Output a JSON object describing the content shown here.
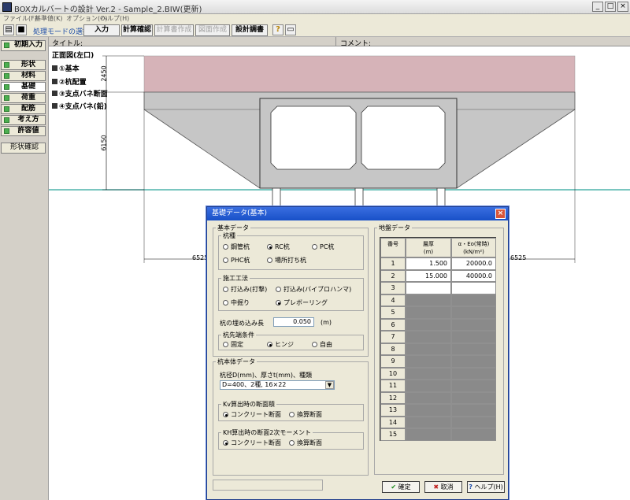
{
  "window": {
    "title": "BOXカルバートの設計 Ver.2 - Sample_2.BIW(更新)",
    "minimize": "_",
    "maximize": "□",
    "close": "×"
  },
  "menu": [
    "ファイル(F)",
    "基準値(K)",
    "オプション(O)",
    "ヘルプ(H)"
  ],
  "toolbar": {
    "mode_label": "処理モードの選択",
    "input": "入力",
    "calc_confirm": "計算確認",
    "calc_doc": "計算書作成",
    "drawing": "図面作成",
    "design_doc": "設計調書",
    "help_icon": "?",
    "open_icon": "📂",
    "save_icon": "💾"
  },
  "leftpanel": {
    "initial": "初期入力",
    "items": [
      "形状",
      "材料",
      "基礎",
      "荷重",
      "配筋",
      "考え方",
      "許容値"
    ],
    "shape_confirm": "形状確認"
  },
  "main": {
    "title_label": "タイトル:",
    "comment_label": "コメント:",
    "view_title": "正面図(左口)",
    "layers": [
      "①基本",
      "②杭配置",
      "③支点バネ断面",
      "④支点バネ(鉛)"
    ],
    "dims": {
      "h1": "2450",
      "h2": "6150",
      "w_left": "6525",
      "w_right": "6525"
    }
  },
  "dialog": {
    "title": "基礎データ(基本)",
    "close": "×",
    "kihon_group": "基本データ",
    "pile_type_label": "杭種",
    "pile_types": [
      "鋼管杭",
      "RC杭",
      "PC杭",
      "PHC杭",
      "場所打ち杭"
    ],
    "pile_type_selected": "RC杭",
    "method_label": "施工工法",
    "methods": [
      "打込み(打撃)",
      "打込み(バイブロハンマ)",
      "中掘り",
      "プレボーリング"
    ],
    "method_selected": "プレボーリング",
    "embed_label": "杭の埋め込み長",
    "embed_value": "0.050",
    "embed_unit": "(m)",
    "tip_label": "杭先端条件",
    "tips": [
      "固定",
      "ヒンジ",
      "自由"
    ],
    "tip_selected": "ヒンジ",
    "body_group": "杭本体データ",
    "dia_label": "杭径D(mm)、厚さt(mm)、種類",
    "dia_value": "D=400、2種, 16×22",
    "kv_label": "Kv算出時の断面積",
    "kv_opts": [
      "コンクリート断面",
      "換算断面"
    ],
    "kv_selected": "コンクリート断面",
    "kh_label": "KH算出時の断面2次モーメント",
    "kh_opts": [
      "コンクリート断面",
      "換算断面"
    ],
    "kh_selected": "コンクリート断面",
    "ground_group": "地盤データ",
    "grid_headers": [
      "番号",
      "層厚\n(m)",
      "α・Eo(常時)\n(kN/m²)"
    ],
    "grid_rows": [
      [
        "1",
        "1.500",
        "20000.0"
      ],
      [
        "2",
        "15.000",
        "40000.0"
      ],
      [
        "3",
        "",
        ""
      ],
      [
        "4",
        "",
        ""
      ],
      [
        "5",
        "",
        ""
      ],
      [
        "6",
        "",
        ""
      ],
      [
        "7",
        "",
        ""
      ],
      [
        "8",
        "",
        ""
      ],
      [
        "9",
        "",
        ""
      ],
      [
        "10",
        "",
        ""
      ],
      [
        "11",
        "",
        ""
      ],
      [
        "12",
        "",
        ""
      ],
      [
        "13",
        "",
        ""
      ],
      [
        "14",
        "",
        ""
      ],
      [
        "15",
        "",
        ""
      ]
    ],
    "ok": "確定",
    "cancel": "取消",
    "help": "ヘルプ(H)"
  },
  "colors": {
    "accent": "#1850c8",
    "fill_top": "#d6b3b8",
    "fill_body": "#c6c6c6",
    "water_line": "#2aa39a"
  }
}
